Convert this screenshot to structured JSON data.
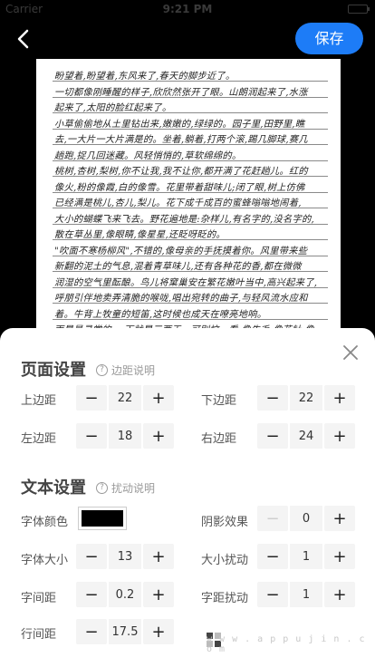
{
  "status_bar": {
    "carrier": "Carrier",
    "time": "9:21 PM"
  },
  "header": {
    "save_label": "保存"
  },
  "paper": {
    "lines": [
      "盼望着,盼望着,东风来了,春天的脚步近了。",
      "一切都像刚睡醒的样子,欣欣然张开了眼。山朗润起来了,水涨",
      "起来了,太阳的脸红起来了。",
      "小草偷偷地从土里钻出来,嫩嫩的,绿绿的。园子里,田野里,瞧",
      "去,一大片一大片满是的。坐着,躺着,打两个滚,踢几脚球,赛几",
      "趟跑,捉几回迷藏。风轻悄悄的,草软绵绵的。",
      "桃树,杏树,梨树,你不让我,我不让你,都开满了花赶趟儿。红的",
      "像火,粉的像霞,白的像雪。花里带着甜味儿;闭了眼,树上仿佛",
      "已经满是桃儿,杏儿,梨儿。花下成千成百的蜜蜂嗡嗡地闹着,",
      "大小的蝴蝶飞来飞去。野花遍地是:杂样儿,有名字的,没名字的,",
      "散在草丛里,像眼睛,像星星,还眨呀眨的。",
      "\"吹面不寒杨柳风\",不错的,像母亲的手抚摸着你。风里带来些",
      "新翻的泥土的气息,混着青草味儿,还有各种花的香,都在微微",
      "润湿的空气里酝酿。鸟儿将窠巢安在繁花嫩叶当中,高兴起来了,",
      "呼朋引伴地卖弄清脆的喉咙,唱出宛转的曲子,与轻风流水应和",
      "着。牛背上牧童的短笛,这时候也成天在嘹亮地响。",
      "雨是最寻常的,一下就是三两天。可别恼。看,像牛毛,像花针,像"
    ]
  },
  "page_settings": {
    "title": "页面设置",
    "help": "边距说明",
    "top_margin": {
      "label": "上边距",
      "value": "22"
    },
    "bottom_margin": {
      "label": "下边距",
      "value": "22"
    },
    "left_margin": {
      "label": "左边距",
      "value": "18"
    },
    "right_margin": {
      "label": "右边距",
      "value": "24"
    }
  },
  "text_settings": {
    "title": "文本设置",
    "help": "扰动说明",
    "font_color": {
      "label": "字体颜色",
      "value": "#000000"
    },
    "shadow": {
      "label": "阴影效果",
      "value": "0"
    },
    "font_size": {
      "label": "字体大小",
      "value": "13"
    },
    "size_jitter": {
      "label": "大小扰动",
      "value": "1"
    },
    "char_spacing": {
      "label": "字间距",
      "value": "0.2"
    },
    "spacing_jitter": {
      "label": "字距扰动",
      "value": "1"
    },
    "line_spacing": {
      "label": "行间距",
      "value": "17.5"
    }
  },
  "stepper_symbols": {
    "minus": "−",
    "plus": "+"
  },
  "watermark": {
    "text": "w w w . a p p u j i n . c o m"
  },
  "icons": {
    "back": "chevron-left-icon",
    "close": "close-icon",
    "help": "question-circle-icon"
  },
  "colors": {
    "accent": "#1d7cf7"
  }
}
